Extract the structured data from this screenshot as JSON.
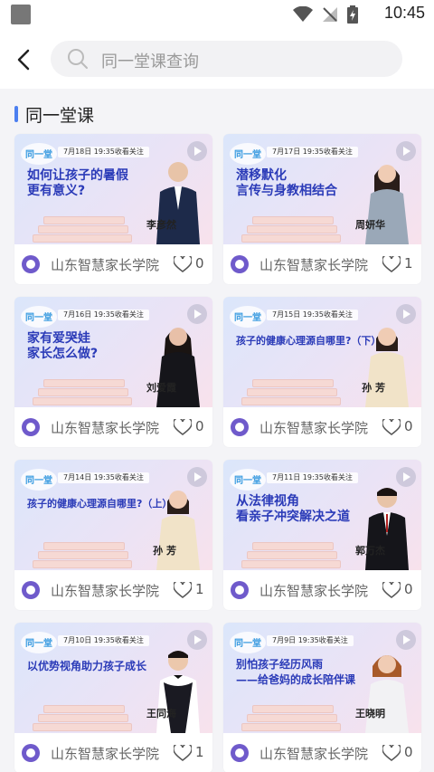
{
  "status_bar": {
    "time": "10:45"
  },
  "header": {
    "search_text": "同一堂课查询"
  },
  "section": {
    "title": "同一堂课"
  },
  "brand": {
    "accent": "#4c7ff0",
    "headline_color": "#2b3bb8"
  },
  "cards": [
    {
      "date": "7月18日 19:35收看关注",
      "headline": "如何让孩子的暑假\n更有意义?",
      "speaker": "李彦然",
      "org": "山东智慧家长学院",
      "likes": "0"
    },
    {
      "date": "7月17日 19:35收看关注",
      "headline": "潜移默化\n言传与身教相结合",
      "speaker": "周妍华",
      "org": "山东智慧家长学院",
      "likes": "1"
    },
    {
      "date": "7月16日 19:35收看关注",
      "headline": "家有爱哭娃\n家长怎么做?",
      "speaker": "刘爱霞",
      "org": "山东智慧家长学院",
      "likes": "0"
    },
    {
      "date": "7月15日 19:35收看关注",
      "headline": "孩子的健康心理源自哪里?（下）",
      "speaker": "孙 芳",
      "org": "山东智慧家长学院",
      "likes": "0"
    },
    {
      "date": "7月14日 19:35收看关注",
      "headline": "孩子的健康心理源自哪里?（上）",
      "speaker": "孙 芳",
      "org": "山东智慧家长学院",
      "likes": "1"
    },
    {
      "date": "7月11日 19:35收看关注",
      "headline": "从法律视角\n看亲子冲突解决之道",
      "speaker": "郭万杰",
      "org": "山东智慧家长学院",
      "likes": "0"
    },
    {
      "date": "7月10日 19:35收看关注",
      "headline": "以优势视角助力孩子成长",
      "speaker": "王同海",
      "org": "山东智慧家长学院",
      "likes": "1"
    },
    {
      "date": "7月9日 19:35收看关注",
      "headline": "别怕孩子经历风雨\n——给爸妈的成长陪伴课",
      "speaker": "王晓明",
      "org": "山东智慧家长学院",
      "likes": "0"
    }
  ]
}
